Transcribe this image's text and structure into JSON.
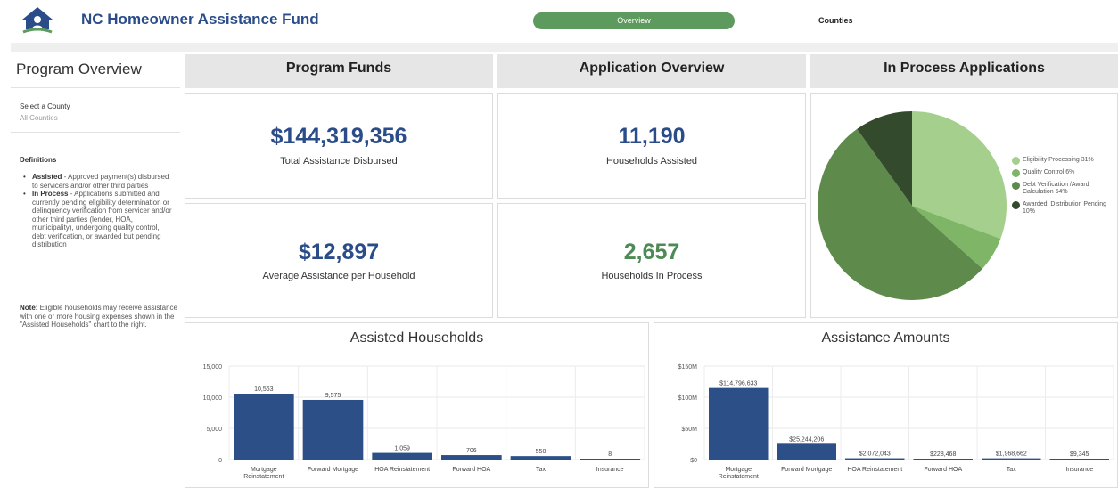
{
  "header": {
    "title": "NC Homeowner Assistance Fund",
    "nav": {
      "overview": "Overview",
      "counties": "Counties"
    }
  },
  "sidebar": {
    "title": "Program Overview",
    "select_label": "Select a County",
    "select_value": "All Counties",
    "definitions_title": "Definitions",
    "definitions": [
      {
        "term": "Assisted",
        "text": " - Approved payment(s) disbursed to servicers and/or other third parties"
      },
      {
        "term": "In Process",
        "text": " - Applications submitted and currently pending eligibility determination or delinquency verification from servicer and/or other third parties (lender, HOA, municipality), undergoing quality control, debt verification, or awarded but pending distribution"
      }
    ],
    "note_label": "Note:",
    "note_text": " Eligible households may receive assistance with one or more housing expenses shown in the \"Assisted Households\" chart to the right."
  },
  "sections": {
    "program_funds": "Program Funds",
    "application_overview": "Application Overview",
    "in_process": "In Process Applications"
  },
  "kpis": {
    "total_disbursed": {
      "value": "$144,319,356",
      "label": "Total Assistance Disbursed"
    },
    "households_assisted": {
      "value": "11,190",
      "label": "Households Assisted"
    },
    "avg_assistance": {
      "value": "$12,897",
      "label": "Average Assistance per Household"
    },
    "households_in_process": {
      "value": "2,657",
      "label": "Households In Process"
    }
  },
  "colors": {
    "brand_blue": "#2a4d8a",
    "bar_blue": "#2b4f86",
    "accent_green": "#5d9a5d",
    "kpi_green": "#4e8a55",
    "pie": [
      "#a4cf8c",
      "#7fb567",
      "#5e8a4c",
      "#344a2c"
    ]
  },
  "chart_data": [
    {
      "type": "pie",
      "title": "In Process Applications",
      "slices": [
        {
          "label": "Eligibility Processing",
          "pct": "31%",
          "value": 31
        },
        {
          "label": "Quality Control",
          "pct": "6%",
          "value": 6
        },
        {
          "label": "Debt Verification /Award Calculation",
          "pct": "54%",
          "value": 54
        },
        {
          "label": "Awarded, Distribution Pending",
          "pct": "10%",
          "value": 10
        }
      ]
    },
    {
      "type": "bar",
      "title": "Assisted Households",
      "categories": [
        "Mortgage Reinstatement",
        "Forward Mortgage",
        "HOA Reinstatement",
        "Forward HOA",
        "Tax",
        "Insurance"
      ],
      "values": [
        10563,
        9575,
        1059,
        706,
        550,
        8
      ],
      "value_labels": [
        "10,563",
        "9,575",
        "1,059",
        "706",
        "550",
        "8"
      ],
      "ylim": [
        0,
        15000
      ],
      "yticks": [
        0,
        5000,
        10000,
        15000
      ],
      "ytick_labels": [
        "0",
        "5,000",
        "10,000",
        "15,000"
      ]
    },
    {
      "type": "bar",
      "title": "Assistance Amounts",
      "categories": [
        "Mortgage Reinstatement",
        "Forward Mortgage",
        "HOA Reinstatement",
        "Forward HOA",
        "Tax",
        "Insurance"
      ],
      "values": [
        114796633,
        25244206,
        2072043,
        228468,
        1968662,
        9345
      ],
      "value_labels": [
        "$114,796,633",
        "$25,244,206",
        "$2,072,043",
        "$228,468",
        "$1,968,662",
        "$9,345"
      ],
      "ylim": [
        0,
        150000000
      ],
      "yticks": [
        0,
        50000000,
        100000000,
        150000000
      ],
      "ytick_labels": [
        "$0",
        "$50M",
        "$100M",
        "$150M"
      ]
    }
  ]
}
